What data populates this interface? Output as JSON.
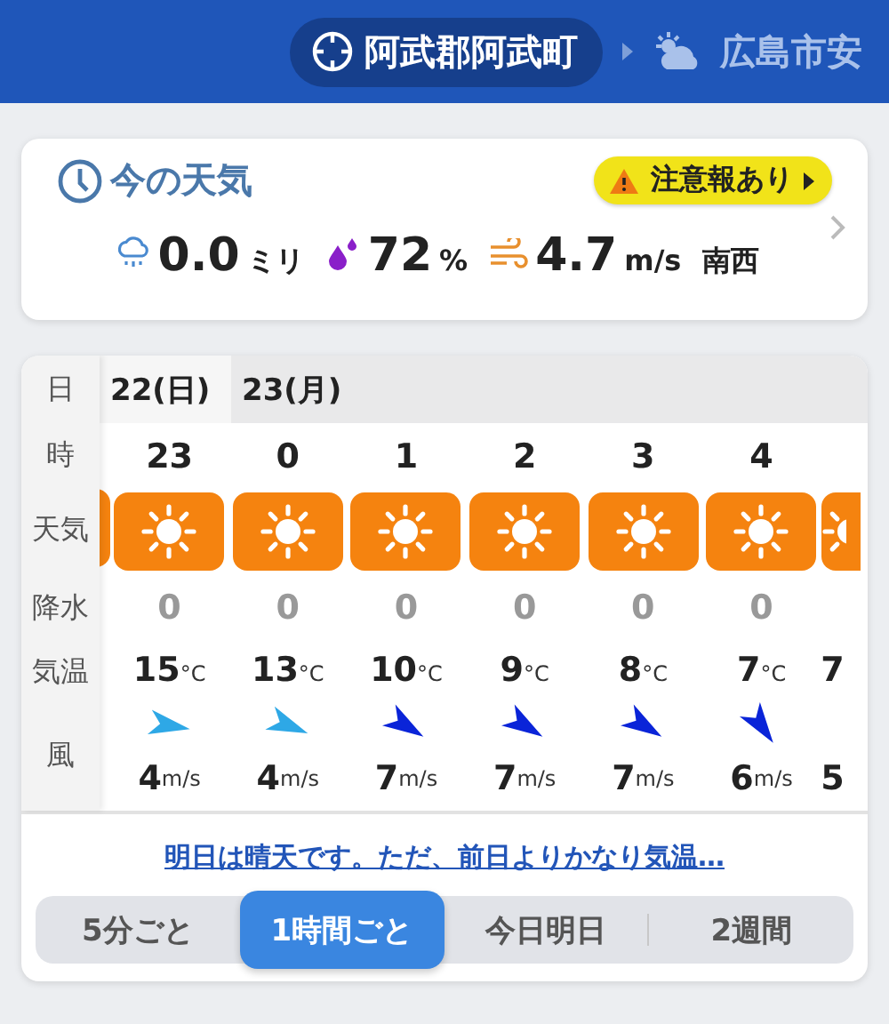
{
  "header": {
    "location": "阿武郡阿武町",
    "next_location": "広島市安"
  },
  "current": {
    "title": "今の天気",
    "alert": "注意報あり",
    "rain": "0.0",
    "rain_unit": "ミリ",
    "humidity": "72",
    "humidity_unit": "%",
    "wind": "4.7",
    "wind_unit": "m/s",
    "wind_dir": "南西"
  },
  "forecast": {
    "row_labels": [
      "日",
      "時",
      "天気",
      "降水",
      "気温",
      "風"
    ],
    "dates": [
      "22(日)",
      "23(月)"
    ],
    "columns": [
      {
        "hour": "23",
        "weather": {
          "kind": "sunny"
        },
        "precip": "0",
        "temp": "15",
        "temp_unit": "°C",
        "arrow": {
          "kind": "west",
          "color": "#2ea8e6"
        },
        "wind": "4",
        "wind_unit": "m/s"
      },
      {
        "hour": "0",
        "weather": {
          "kind": "sunny"
        },
        "precip": "0",
        "temp": "13",
        "temp_unit": "°C",
        "arrow": {
          "kind": "westnorthwest",
          "color": "#2ea8e6"
        },
        "wind": "4",
        "wind_unit": "m/s"
      },
      {
        "hour": "1",
        "weather": {
          "kind": "sunny"
        },
        "precip": "0",
        "temp": "10",
        "temp_unit": "°C",
        "arrow": {
          "kind": "northwestwest",
          "color": "#0a24d8"
        },
        "wind": "7",
        "wind_unit": "m/s"
      },
      {
        "hour": "2",
        "weather": {
          "kind": "sunny"
        },
        "precip": "0",
        "temp": "9",
        "temp_unit": "°C",
        "arrow": {
          "kind": "northwestwest",
          "color": "#0a24d8"
        },
        "wind": "7",
        "wind_unit": "m/s"
      },
      {
        "hour": "3",
        "weather": {
          "kind": "sunny"
        },
        "precip": "0",
        "temp": "8",
        "temp_unit": "°C",
        "arrow": {
          "kind": "northwestwest",
          "color": "#0a24d8"
        },
        "wind": "7",
        "wind_unit": "m/s"
      },
      {
        "hour": "4",
        "weather": {
          "kind": "sunny"
        },
        "precip": "0",
        "temp": "7",
        "temp_unit": "°C",
        "arrow": {
          "kind": "northwest",
          "color": "#0a24d8"
        },
        "wind": "6",
        "wind_unit": "m/s"
      },
      {
        "weather": {
          "kind": "sunny"
        },
        "temp": "7",
        "wind": "5"
      }
    ],
    "summary": "明日は晴天です。ただ、前日よりかなり気温…",
    "tabs": [
      {
        "label": "5分ごと",
        "selected": false
      },
      {
        "label": "1時間ごと",
        "selected": true
      },
      {
        "label": "今日明日",
        "selected": false
      },
      {
        "label": "2週間",
        "selected": false
      }
    ]
  }
}
